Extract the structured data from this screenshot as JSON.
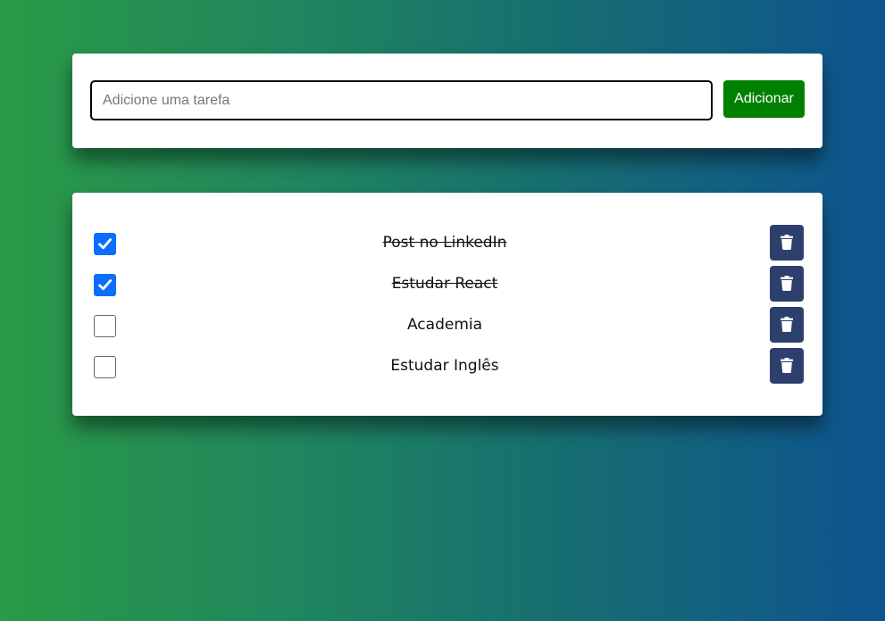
{
  "new_task": {
    "placeholder": "Adicione uma tarefa",
    "value": "",
    "add_label": "Adicionar"
  },
  "tasks": [
    {
      "label": "Post no LinkedIn",
      "done": true
    },
    {
      "label": "Estudar React",
      "done": true
    },
    {
      "label": "Academia",
      "done": false
    },
    {
      "label": "Estudar Inglês",
      "done": false
    }
  ],
  "icons": {
    "delete": "trash-icon",
    "check": "checkmark-icon"
  },
  "colors": {
    "add_button": "#008000",
    "delete_button": "#2d3f6c",
    "checkbox_checked": "#0d6efd",
    "gradient_start": "#2a9a46",
    "gradient_end": "#0e5490"
  }
}
